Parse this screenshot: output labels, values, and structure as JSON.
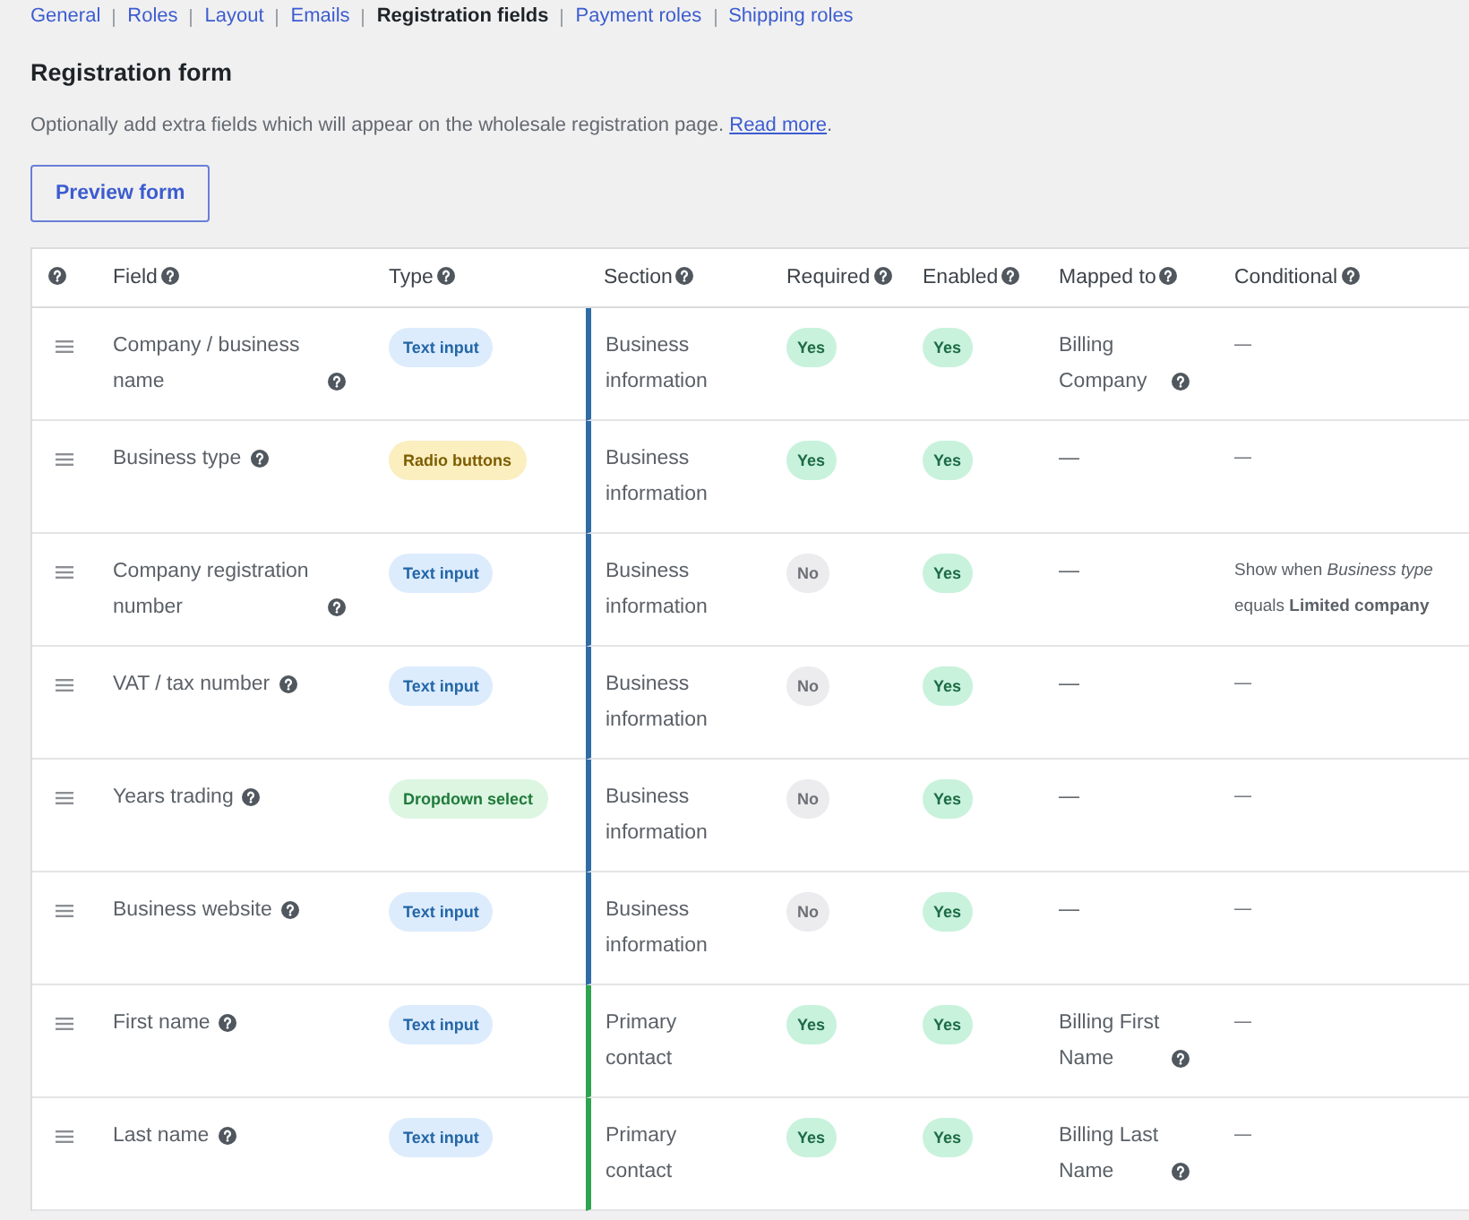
{
  "nav": {
    "tabs": [
      {
        "label": "General",
        "selected": false
      },
      {
        "label": "Roles",
        "selected": false
      },
      {
        "label": "Layout",
        "selected": false
      },
      {
        "label": "Emails",
        "selected": false
      },
      {
        "label": "Registration fields",
        "selected": true
      },
      {
        "label": "Payment roles",
        "selected": false
      },
      {
        "label": "Shipping roles",
        "selected": false
      }
    ]
  },
  "heading": "Registration form",
  "description": {
    "text": "Optionally add extra fields which will appear on the wholesale registration page.",
    "link": "Read more",
    "suffix": "."
  },
  "preview_button": "Preview form",
  "table": {
    "columns": [
      {
        "help": true
      },
      {
        "label": "Field",
        "help": true
      },
      {
        "label": "Type",
        "help": true
      },
      {
        "label": "Section",
        "help": true
      },
      {
        "label": "Required",
        "help": true
      },
      {
        "label": "Enabled",
        "help": true
      },
      {
        "label": "Mapped to",
        "help": true
      },
      {
        "label": "Conditional",
        "help": true
      }
    ],
    "rows": [
      {
        "field": {
          "text": "Company / business name",
          "help": true
        },
        "type": {
          "label": "Text input",
          "kind": "input"
        },
        "section": {
          "text": "Business information",
          "color": "#2f6ca6"
        },
        "required": {
          "label": "Yes",
          "kind": "yes"
        },
        "enabled": {
          "label": "Yes",
          "kind": "yes"
        },
        "mapped_to": {
          "text": "Billing Company",
          "help": true
        },
        "conditional": "—"
      },
      {
        "field": {
          "text": "Business type",
          "help": true
        },
        "type": {
          "label": "Radio buttons",
          "kind": "radio"
        },
        "section": {
          "text": "Business information",
          "color": "#2f6ca6"
        },
        "required": {
          "label": "Yes",
          "kind": "yes"
        },
        "enabled": {
          "label": "Yes",
          "kind": "yes"
        },
        "mapped_to": {
          "text": "—",
          "help": false
        },
        "conditional": "—"
      },
      {
        "field": {
          "text": "Company registration number",
          "help": true
        },
        "type": {
          "label": "Text input",
          "kind": "input"
        },
        "section": {
          "text": "Business information",
          "color": "#2f6ca6"
        },
        "required": {
          "label": "No",
          "kind": "no"
        },
        "enabled": {
          "label": "Yes",
          "kind": "yes"
        },
        "mapped_to": {
          "text": "—",
          "help": false
        },
        "conditional": "Show when *Business type* equals **Limited company**"
      },
      {
        "field": {
          "text": "VAT / tax number",
          "help": true
        },
        "type": {
          "label": "Text input",
          "kind": "input"
        },
        "section": {
          "text": "Business information",
          "color": "#2f6ca6"
        },
        "required": {
          "label": "No",
          "kind": "no"
        },
        "enabled": {
          "label": "Yes",
          "kind": "yes"
        },
        "mapped_to": {
          "text": "—",
          "help": false
        },
        "conditional": "—"
      },
      {
        "field": {
          "text": "Years trading",
          "help": true
        },
        "type": {
          "label": "Dropdown select",
          "kind": "select"
        },
        "section": {
          "text": "Business information",
          "color": "#2f6ca6"
        },
        "required": {
          "label": "No",
          "kind": "no"
        },
        "enabled": {
          "label": "Yes",
          "kind": "yes"
        },
        "mapped_to": {
          "text": "—",
          "help": false
        },
        "conditional": "—"
      },
      {
        "field": {
          "text": "Business website",
          "help": true
        },
        "type": {
          "label": "Text input",
          "kind": "input"
        },
        "section": {
          "text": "Business information",
          "color": "#2f6ca6"
        },
        "required": {
          "label": "No",
          "kind": "no"
        },
        "enabled": {
          "label": "Yes",
          "kind": "yes"
        },
        "mapped_to": {
          "text": "—",
          "help": false
        },
        "conditional": "—"
      },
      {
        "field": {
          "text": "First name",
          "help": true
        },
        "type": {
          "label": "Text input",
          "kind": "input"
        },
        "section": {
          "text": "Primary contact",
          "color": "#2da44e"
        },
        "required": {
          "label": "Yes",
          "kind": "yes"
        },
        "enabled": {
          "label": "Yes",
          "kind": "yes"
        },
        "mapped_to": {
          "text": "Billing First Name",
          "help": true
        },
        "conditional": "—"
      },
      {
        "field": {
          "text": "Last name",
          "help": true
        },
        "type": {
          "label": "Text input",
          "kind": "input"
        },
        "section": {
          "text": "Primary contact",
          "color": "#2da44e"
        },
        "required": {
          "label": "Yes",
          "kind": "yes"
        },
        "enabled": {
          "label": "Yes",
          "kind": "yes"
        },
        "mapped_to": {
          "text": "Billing Last Name",
          "help": true
        },
        "conditional": "—"
      }
    ]
  }
}
